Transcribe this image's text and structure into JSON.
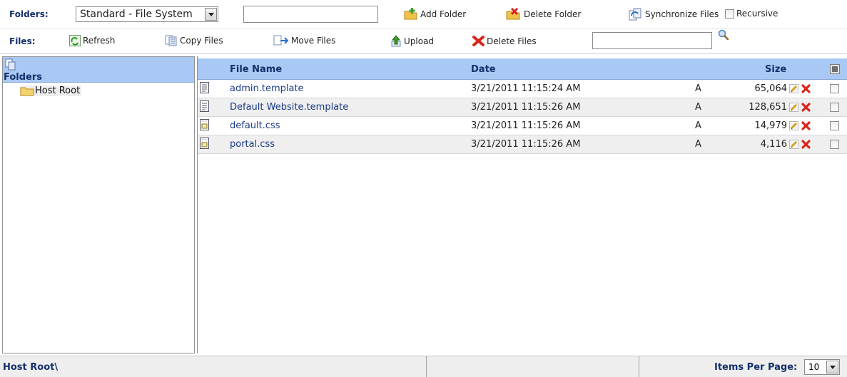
{
  "toolbar_folders": {
    "label": "Folders:",
    "storage_select": "Standard - File System",
    "folder_input_value": "",
    "add_folder": "Add Folder",
    "delete_folder": "Delete Folder",
    "synchronize_files": "Synchronize Files",
    "recursive": "Recursive"
  },
  "toolbar_files": {
    "label": "Files:",
    "refresh": "Refresh",
    "copy_files": "Copy Files",
    "move_files": "Move Files",
    "upload": "Upload",
    "delete_files": "Delete Files",
    "search_value": ""
  },
  "folder_panel": {
    "header": "Folders",
    "tree": [
      "Host Root"
    ]
  },
  "grid": {
    "columns": {
      "name": "File Name",
      "date": "Date",
      "size": "Size"
    },
    "rows": [
      {
        "name": "admin.template",
        "date": "3/21/2011 11:15:24 AM",
        "attr": "A",
        "size": "65,064",
        "icon": "template-file-icon"
      },
      {
        "name": "Default Website.template",
        "date": "3/21/2011 11:15:26 AM",
        "attr": "A",
        "size": "128,651",
        "icon": "template-file-icon"
      },
      {
        "name": "default.css",
        "date": "3/21/2011 11:15:26 AM",
        "attr": "A",
        "size": "14,979",
        "icon": "css-file-icon"
      },
      {
        "name": "portal.css",
        "date": "3/21/2011 11:15:26 AM",
        "attr": "A",
        "size": "4,116",
        "icon": "css-file-icon"
      }
    ]
  },
  "status_bar": {
    "path": "Host Root\\",
    "items_per_page_label": "Items Per Page:",
    "items_per_page_value": "10"
  },
  "colors": {
    "header_bg": "#a9c8f3",
    "label_text": "#14306b",
    "link_text": "#1c3b86",
    "alt_row": "#efefef",
    "delete_red": "#d8261c"
  }
}
